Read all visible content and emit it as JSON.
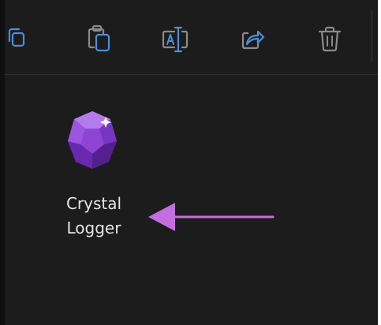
{
  "toolbar": {
    "buttons": [
      {
        "name": "cut",
        "icon": "cut-icon"
      },
      {
        "name": "copy",
        "icon": "copy-icon"
      },
      {
        "name": "rename",
        "icon": "rename-icon"
      },
      {
        "name": "share",
        "icon": "share-icon"
      },
      {
        "name": "delete",
        "icon": "trash-icon"
      }
    ],
    "icon_color": "#4a90d9"
  },
  "items": [
    {
      "label": "Crystal\nLogger",
      "icon": "purple-crystal-icon",
      "icon_color": "#8a3fd1"
    }
  ],
  "annotation": {
    "type": "arrow",
    "color": "#c36ee0"
  }
}
